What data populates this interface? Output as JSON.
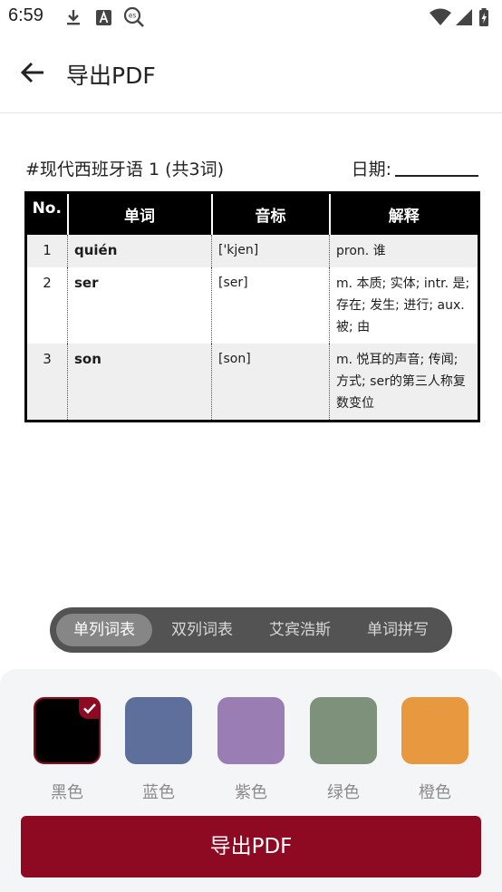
{
  "status_bar": {
    "time": "6:59",
    "icons": [
      "download-icon",
      "font-a-icon",
      "es-search-icon",
      "wifi-icon",
      "signal-icon",
      "battery-icon"
    ]
  },
  "app_bar": {
    "title": "导出PDF",
    "back_icon": "arrow-back-icon"
  },
  "document": {
    "title": "#现代西班牙语 1  (共3词)",
    "date_label": "日期:",
    "table": {
      "headers": [
        "No.",
        "单词",
        "音标",
        "解释"
      ],
      "rows": [
        {
          "no": "1",
          "word": "quién",
          "phonetic": "['kjen]",
          "definition": "pron. 谁"
        },
        {
          "no": "2",
          "word": "ser",
          "phonetic": "[ser]",
          "definition": "m. 本质; 实体; intr. 是; 存在; 发生; 进行; aux. 被; 由"
        },
        {
          "no": "3",
          "word": "son",
          "phonetic": "[son]",
          "definition": "m. 悦耳的声音; 传闻; 方式; ser的第三人称复数变位"
        }
      ]
    }
  },
  "tabs": [
    {
      "label": "单列词表",
      "active": true
    },
    {
      "label": "双列词表",
      "active": false
    },
    {
      "label": "艾宾浩斯",
      "active": false
    },
    {
      "label": "单词拼写",
      "active": false
    }
  ],
  "colors": [
    {
      "label": "黑色",
      "hex": "#000000",
      "selected": true
    },
    {
      "label": "蓝色",
      "hex": "#5f6f9c",
      "selected": false
    },
    {
      "label": "紫色",
      "hex": "#9a7db3",
      "selected": false
    },
    {
      "label": "绿色",
      "hex": "#7e917b",
      "selected": false
    },
    {
      "label": "橙色",
      "hex": "#e8993f",
      "selected": false
    }
  ],
  "export_button": {
    "label": "导出PDF",
    "color": "#8e0a22"
  }
}
